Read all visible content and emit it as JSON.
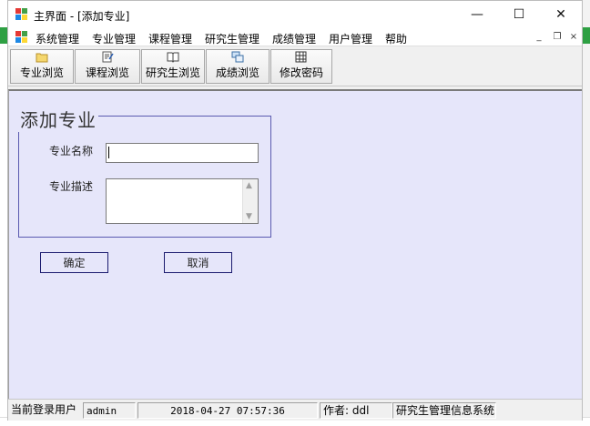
{
  "window": {
    "title": "主界面 - [添加专业]",
    "controls": {
      "minimize": "—",
      "maximize": "☐",
      "close": "✕"
    }
  },
  "menu": {
    "items": [
      "系统管理",
      "专业管理",
      "课程管理",
      "研究生管理",
      "成绩管理",
      "用户管理",
      "帮助"
    ],
    "mdi_controls": {
      "minimize": "_",
      "restore": "❐",
      "close": "×"
    }
  },
  "toolbar": {
    "buttons": [
      {
        "label": "专业浏览",
        "icon": "folder-icon"
      },
      {
        "label": "课程浏览",
        "icon": "edit-doc-icon"
      },
      {
        "label": "研究生浏览",
        "icon": "book-icon"
      },
      {
        "label": "成绩浏览",
        "icon": "windows-stack-icon"
      },
      {
        "label": "修改密码",
        "icon": "grid-icon"
      }
    ]
  },
  "form": {
    "group_title": "添加专业",
    "name_label": "专业名称",
    "name_value": "",
    "desc_label": "专业描述",
    "desc_value": "",
    "ok_label": "确定",
    "cancel_label": "取消"
  },
  "status": {
    "user_label": "当前登录用户",
    "user_value": "admin",
    "datetime": "2018-04-27 07:57:36",
    "author": "作者: ddl",
    "system": "研究生管理信息系统"
  },
  "colors": {
    "form_bg": "#e6e6fa",
    "group_border": "#5a5ab0",
    "button_border": "#1a1a6e"
  }
}
